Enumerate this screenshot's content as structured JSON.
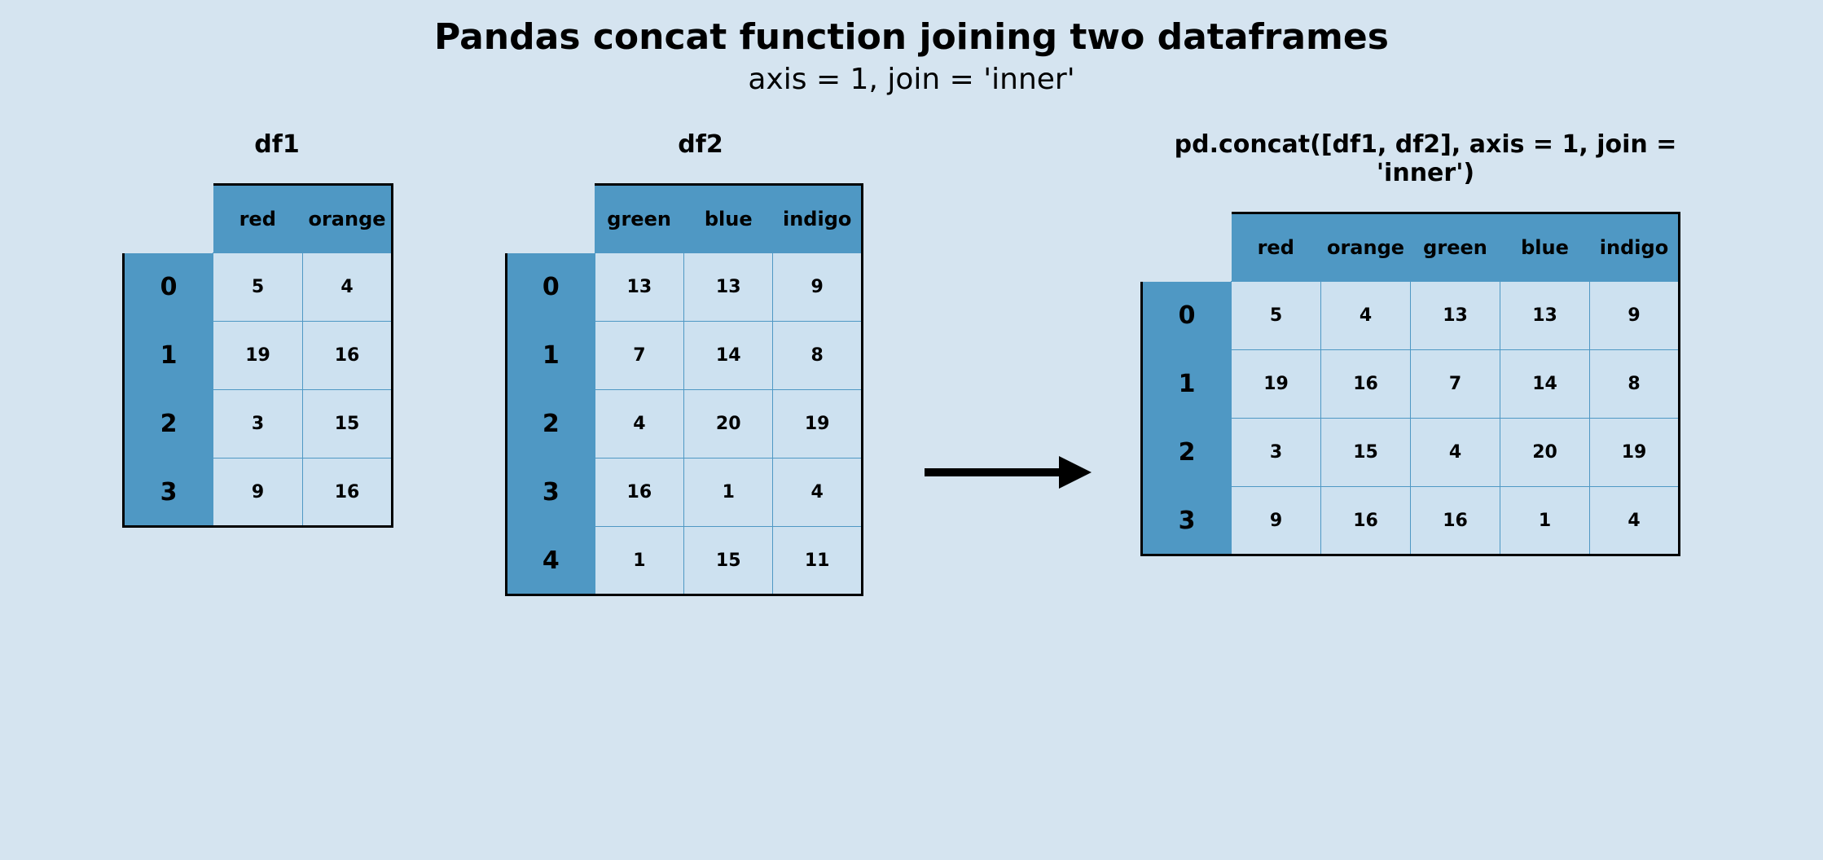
{
  "title": "Pandas concat function joining two dataframes",
  "subtitle": "axis = 1, join = 'inner'",
  "chart_data": {
    "type": "table",
    "tables": [
      {
        "name": "df1",
        "label": "df1",
        "columns": [
          "red",
          "orange"
        ],
        "index": [
          "0",
          "1",
          "2",
          "3"
        ],
        "data": [
          [
            5,
            4
          ],
          [
            19,
            16
          ],
          [
            3,
            15
          ],
          [
            9,
            16
          ]
        ]
      },
      {
        "name": "df2",
        "label": "df2",
        "columns": [
          "green",
          "blue",
          "indigo"
        ],
        "index": [
          "0",
          "1",
          "2",
          "3",
          "4"
        ],
        "data": [
          [
            13,
            13,
            9
          ],
          [
            7,
            14,
            8
          ],
          [
            4,
            20,
            19
          ],
          [
            16,
            1,
            4
          ],
          [
            1,
            15,
            11
          ]
        ]
      },
      {
        "name": "result",
        "label": "pd.concat([df1, df2], axis = 1, join = 'inner')",
        "columns": [
          "red",
          "orange",
          "green",
          "blue",
          "indigo"
        ],
        "index": [
          "0",
          "1",
          "2",
          "3"
        ],
        "data": [
          [
            5,
            4,
            13,
            13,
            9
          ],
          [
            19,
            16,
            7,
            14,
            8
          ],
          [
            3,
            15,
            4,
            20,
            19
          ],
          [
            9,
            16,
            16,
            1,
            4
          ]
        ]
      }
    ]
  }
}
